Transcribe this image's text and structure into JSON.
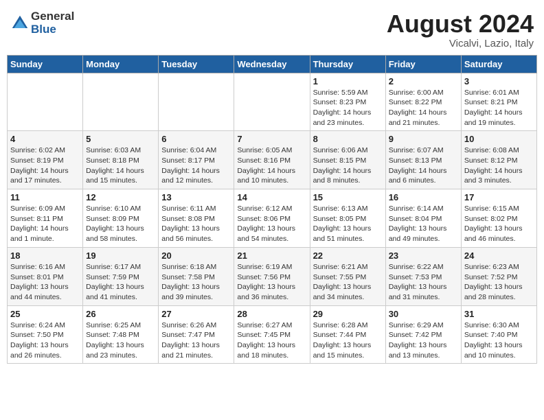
{
  "header": {
    "logo_general": "General",
    "logo_blue": "Blue",
    "month_year": "August 2024",
    "location": "Vicalvi, Lazio, Italy"
  },
  "days_of_week": [
    "Sunday",
    "Monday",
    "Tuesday",
    "Wednesday",
    "Thursday",
    "Friday",
    "Saturday"
  ],
  "weeks": [
    [
      {
        "day": "",
        "info": ""
      },
      {
        "day": "",
        "info": ""
      },
      {
        "day": "",
        "info": ""
      },
      {
        "day": "",
        "info": ""
      },
      {
        "day": "1",
        "info": "Sunrise: 5:59 AM\nSunset: 8:23 PM\nDaylight: 14 hours\nand 23 minutes."
      },
      {
        "day": "2",
        "info": "Sunrise: 6:00 AM\nSunset: 8:22 PM\nDaylight: 14 hours\nand 21 minutes."
      },
      {
        "day": "3",
        "info": "Sunrise: 6:01 AM\nSunset: 8:21 PM\nDaylight: 14 hours\nand 19 minutes."
      }
    ],
    [
      {
        "day": "4",
        "info": "Sunrise: 6:02 AM\nSunset: 8:19 PM\nDaylight: 14 hours\nand 17 minutes."
      },
      {
        "day": "5",
        "info": "Sunrise: 6:03 AM\nSunset: 8:18 PM\nDaylight: 14 hours\nand 15 minutes."
      },
      {
        "day": "6",
        "info": "Sunrise: 6:04 AM\nSunset: 8:17 PM\nDaylight: 14 hours\nand 12 minutes."
      },
      {
        "day": "7",
        "info": "Sunrise: 6:05 AM\nSunset: 8:16 PM\nDaylight: 14 hours\nand 10 minutes."
      },
      {
        "day": "8",
        "info": "Sunrise: 6:06 AM\nSunset: 8:15 PM\nDaylight: 14 hours\nand 8 minutes."
      },
      {
        "day": "9",
        "info": "Sunrise: 6:07 AM\nSunset: 8:13 PM\nDaylight: 14 hours\nand 6 minutes."
      },
      {
        "day": "10",
        "info": "Sunrise: 6:08 AM\nSunset: 8:12 PM\nDaylight: 14 hours\nand 3 minutes."
      }
    ],
    [
      {
        "day": "11",
        "info": "Sunrise: 6:09 AM\nSunset: 8:11 PM\nDaylight: 14 hours\nand 1 minute."
      },
      {
        "day": "12",
        "info": "Sunrise: 6:10 AM\nSunset: 8:09 PM\nDaylight: 13 hours\nand 58 minutes."
      },
      {
        "day": "13",
        "info": "Sunrise: 6:11 AM\nSunset: 8:08 PM\nDaylight: 13 hours\nand 56 minutes."
      },
      {
        "day": "14",
        "info": "Sunrise: 6:12 AM\nSunset: 8:06 PM\nDaylight: 13 hours\nand 54 minutes."
      },
      {
        "day": "15",
        "info": "Sunrise: 6:13 AM\nSunset: 8:05 PM\nDaylight: 13 hours\nand 51 minutes."
      },
      {
        "day": "16",
        "info": "Sunrise: 6:14 AM\nSunset: 8:04 PM\nDaylight: 13 hours\nand 49 minutes."
      },
      {
        "day": "17",
        "info": "Sunrise: 6:15 AM\nSunset: 8:02 PM\nDaylight: 13 hours\nand 46 minutes."
      }
    ],
    [
      {
        "day": "18",
        "info": "Sunrise: 6:16 AM\nSunset: 8:01 PM\nDaylight: 13 hours\nand 44 minutes."
      },
      {
        "day": "19",
        "info": "Sunrise: 6:17 AM\nSunset: 7:59 PM\nDaylight: 13 hours\nand 41 minutes."
      },
      {
        "day": "20",
        "info": "Sunrise: 6:18 AM\nSunset: 7:58 PM\nDaylight: 13 hours\nand 39 minutes."
      },
      {
        "day": "21",
        "info": "Sunrise: 6:19 AM\nSunset: 7:56 PM\nDaylight: 13 hours\nand 36 minutes."
      },
      {
        "day": "22",
        "info": "Sunrise: 6:21 AM\nSunset: 7:55 PM\nDaylight: 13 hours\nand 34 minutes."
      },
      {
        "day": "23",
        "info": "Sunrise: 6:22 AM\nSunset: 7:53 PM\nDaylight: 13 hours\nand 31 minutes."
      },
      {
        "day": "24",
        "info": "Sunrise: 6:23 AM\nSunset: 7:52 PM\nDaylight: 13 hours\nand 28 minutes."
      }
    ],
    [
      {
        "day": "25",
        "info": "Sunrise: 6:24 AM\nSunset: 7:50 PM\nDaylight: 13 hours\nand 26 minutes."
      },
      {
        "day": "26",
        "info": "Sunrise: 6:25 AM\nSunset: 7:48 PM\nDaylight: 13 hours\nand 23 minutes."
      },
      {
        "day": "27",
        "info": "Sunrise: 6:26 AM\nSunset: 7:47 PM\nDaylight: 13 hours\nand 21 minutes."
      },
      {
        "day": "28",
        "info": "Sunrise: 6:27 AM\nSunset: 7:45 PM\nDaylight: 13 hours\nand 18 minutes."
      },
      {
        "day": "29",
        "info": "Sunrise: 6:28 AM\nSunset: 7:44 PM\nDaylight: 13 hours\nand 15 minutes."
      },
      {
        "day": "30",
        "info": "Sunrise: 6:29 AM\nSunset: 7:42 PM\nDaylight: 13 hours\nand 13 minutes."
      },
      {
        "day": "31",
        "info": "Sunrise: 6:30 AM\nSunset: 7:40 PM\nDaylight: 13 hours\nand 10 minutes."
      }
    ]
  ]
}
